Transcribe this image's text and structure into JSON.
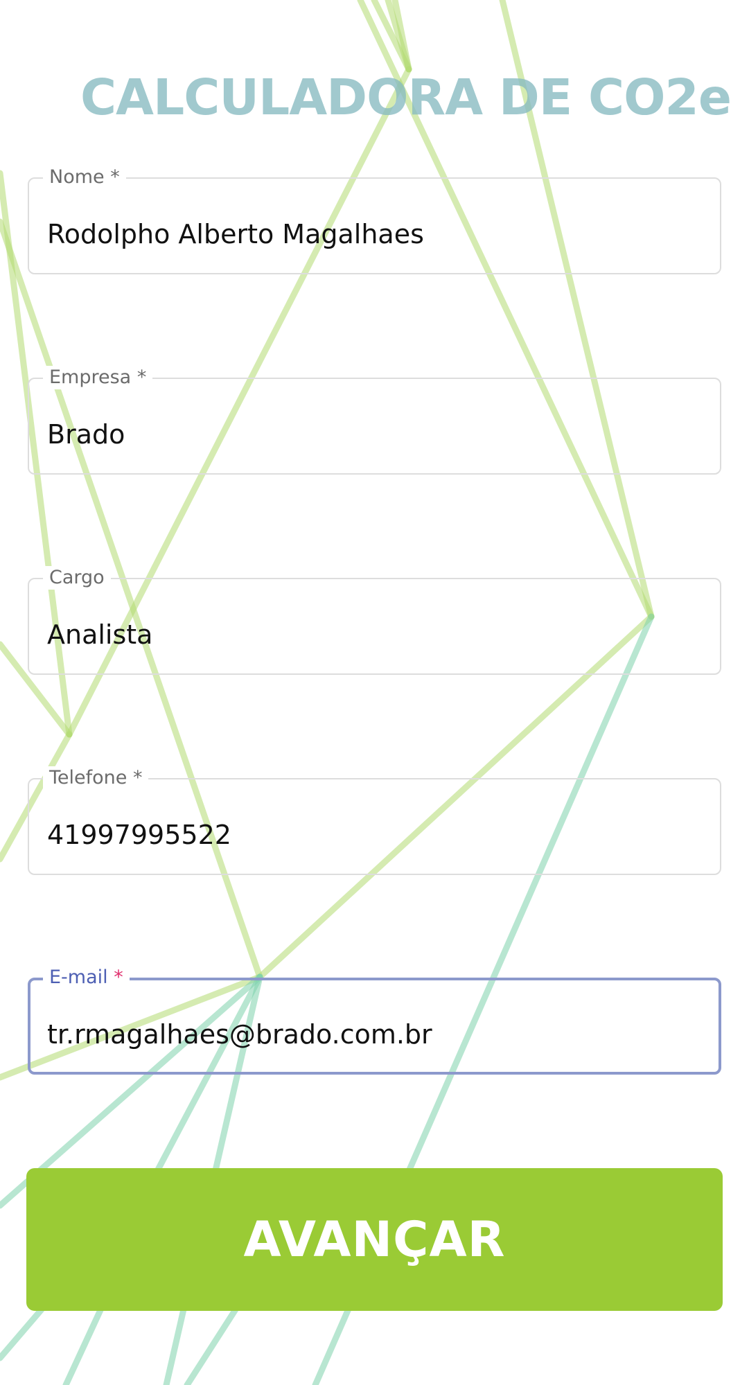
{
  "header": {
    "title": "CALCULADORA DE CO2e"
  },
  "form": {
    "fields": [
      {
        "label": "Nome",
        "required_mark": " *",
        "value": "Rodolpho Alberto Magalhaes"
      },
      {
        "label": "Empresa",
        "required_mark": " *",
        "value": "Brado"
      },
      {
        "label": "Cargo",
        "required_mark": "",
        "value": "Analista"
      },
      {
        "label": "Telefone",
        "required_mark": " *",
        "value": "41997995522"
      },
      {
        "label": "E-mail",
        "required_mark": " *",
        "value": "tr.rmagalhaes@brado.com.br",
        "focused": true
      }
    ],
    "submit_label": "AVANÇAR"
  },
  "colors": {
    "title": "#86bac0",
    "button": "#9acb35",
    "focus_border": "#8c99cc",
    "focus_label": "#4d5fb3",
    "required_asterisk": "#e0316f",
    "decor_line_green": "#a8d46a",
    "decor_line_teal": "#6fcfa8"
  }
}
